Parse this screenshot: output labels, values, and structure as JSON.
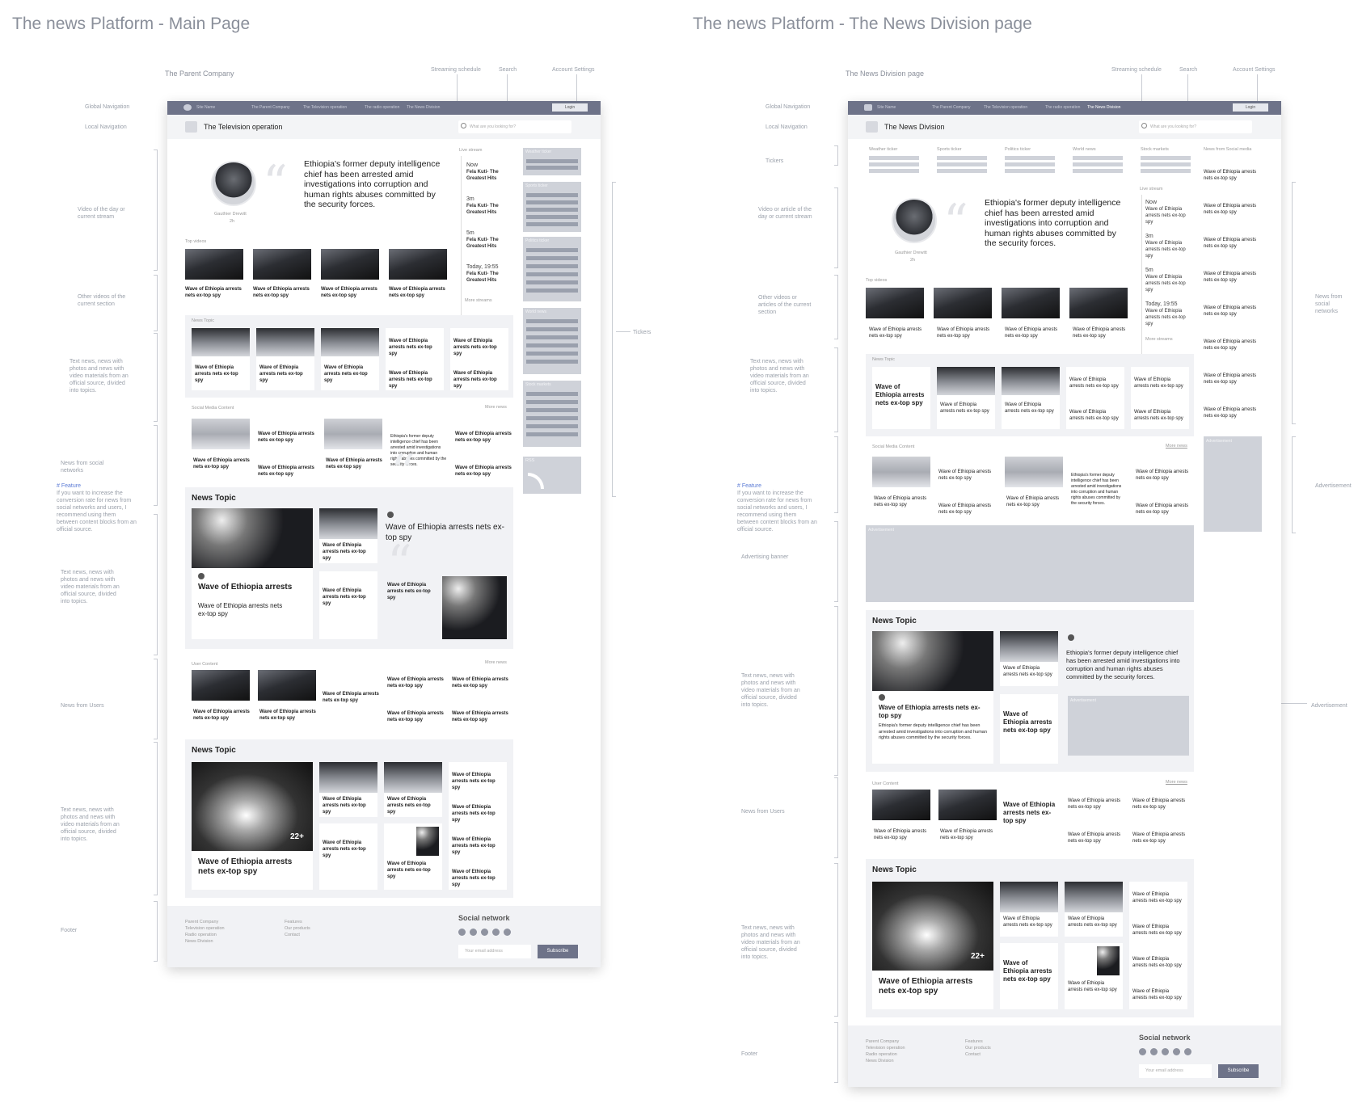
{
  "left": {
    "title": "The news Platform - Main Page",
    "company": "The Parent Company",
    "streaming": "Streaming schedule",
    "search": "Search",
    "account": "Account Settings",
    "annotations": [
      "Global Navigation",
      "Local Navigation",
      "Video of the day or current stream",
      "Other videos of the current section",
      "Text news, news with photos and news with video materials from an official source, divided into topics.",
      "News from social networks",
      "If you want to increase the conversion rate for news from social networks and users, I recommend using them between content blocks from an official source.",
      "Text news, news with photos and news with video materials from an official source, divided into topics.",
      "News from Users",
      "Text news, news with photos and news with video materials from an official source, divided into topics.",
      "Footer",
      "Tickers"
    ],
    "feature": "# Feature",
    "page": {
      "local_name": "The Television operation",
      "search_ph": "What are you looking for?",
      "login": "Login",
      "brand": "Site Name",
      "nav": [
        "The Parent Company",
        "The Television operation",
        "The radio operation",
        "The News Division"
      ],
      "hero_quote": "Ethiopia's former deputy intelligence chief has been arrested amid investigations into corruption and human rights abuses committed by the security forces.",
      "author": "Gauthier Drewitt",
      "time": "2h",
      "live": "Live stream",
      "stream_items": [
        {
          "t": "Now",
          "s": "Fela Kuti- The Greatest Hits"
        },
        {
          "t": "3m",
          "s": "Fela Kuti- The Greatest Hits"
        },
        {
          "t": "5m",
          "s": "Fela Kuti- The Greatest Hits"
        },
        {
          "t": "Today, 19:55",
          "s": "Fela Kuti- The Greatest Hits"
        }
      ],
      "more_streams": "More streams",
      "top_videos": "Top videos",
      "item": "Wave of Ethiopia arrests nets ex-top spy",
      "item_short": "Wave of Ethiopia arrests",
      "news_topic_small": "News Topic",
      "social": "Social Media Content",
      "more_news": "More news",
      "news_topic": "News Topic",
      "user_content": "User Content",
      "tickers": [
        "Weather ticker",
        "Sports ticker",
        "Politics ticker",
        "World news",
        "Stock markets",
        "RSS"
      ],
      "counter": "22+",
      "footer_links": [
        "Parent Company",
        "Television operation",
        "Radio operation",
        "News Division"
      ],
      "footer_links2": [
        "Features",
        "Our products",
        "Contact"
      ],
      "social_network": "Social network",
      "email_ph": "Your email address",
      "subscribe": "Subscribe"
    }
  },
  "right": {
    "title": "The news Platform - The News Division page",
    "company": "The News Division page",
    "local_name": "The News Division",
    "nav_active": "The News Division",
    "annotations": [
      "Global Navigation",
      "Local Navigation",
      "Tickers",
      "Video or article of the day or current stream",
      "Other videos or articles of the current section",
      "Text news, news with photos and news with video materials from an official source, divided into topics.",
      "If you want to increase the conversion rate for news from social networks and users, I recommend using them between content blocks from an official source.",
      "Advertising banner",
      "Text news, news with photos and news with video materials from an official source, divided into topics.",
      "News from Users",
      "Text news, news with photos and news with video materials from an official source, divided into topics.",
      "Footer",
      "News from social networks",
      "Advertisement",
      "Advertisement"
    ],
    "tickers": [
      "Weather ticker",
      "Sports ticker",
      "Politics ticker",
      "World news",
      "Stock markets"
    ],
    "social_col": "News from Social media",
    "advertisement": "Advertisement"
  }
}
